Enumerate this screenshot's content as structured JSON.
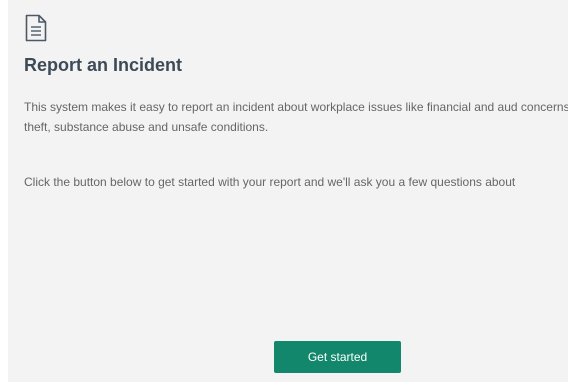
{
  "header": {
    "icon": "document-icon",
    "title": "Report an Incident"
  },
  "content": {
    "paragraph1": "This system makes it easy to report an incident about workplace issues like financial and aud concerns, harassment, theft, substance abuse and unsafe conditions.",
    "paragraph2": "Click the button below to get started with your report and we'll ask you a few questions about"
  },
  "actions": {
    "get_started_label": "Get started"
  },
  "colors": {
    "panel_bg": "#f3f3f3",
    "title": "#3d4a57",
    "body_text": "#666666",
    "button_bg": "#12876b",
    "button_text": "#ffffff"
  }
}
